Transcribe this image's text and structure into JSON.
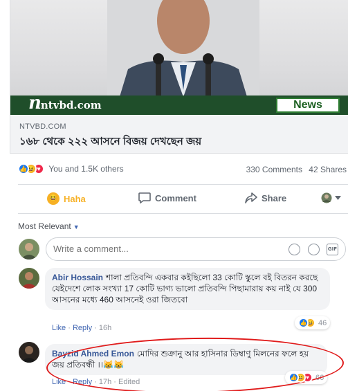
{
  "preview": {
    "brand_logo": "ntvbd.com",
    "badge": "News",
    "domain": "NTVBD.COM",
    "headline": "১৬৮ থেকে ২২২ আসনে বিজয় দেখছেন জয়"
  },
  "stats": {
    "reactions": [
      "like",
      "haha",
      "love"
    ],
    "others": "You and 1.5K others",
    "comments": "330 Comments",
    "shares": "42 Shares"
  },
  "actions": {
    "reaction": "Haha",
    "comment": "Comment",
    "share": "Share"
  },
  "sort": {
    "label": "Most Relevant"
  },
  "composer": {
    "placeholder": "Write a comment..."
  },
  "comments": [
    {
      "author": "Abir Hossain",
      "text": "শালা প্রতিবন্দি একবার কইছিলো 33 কোটি স্কুলে বই বিতরন করছে যেইদেশে লোক সংখ্যা 17 কোটি ভাগ্য ভালো প্রতিবন্দি পিছামারায় কয় নাই যে 300 আসনের মধ্যে 460 আসনেই ওরা জিতবো",
      "like": "Like",
      "reply": "Reply",
      "time": "16h",
      "reaction_count": "46"
    },
    {
      "author": "Bayzid Ahmed Emon",
      "text": "মোদির শুক্রানু আর হাসিনার ডিম্বাণু মিলনের ফলে হয় জয় প্রতিবন্ধী ।।😹😹",
      "like": "Like",
      "reply": "Reply",
      "time": "17h",
      "edited": "Edited",
      "reaction_count": "66"
    }
  ],
  "colors": {
    "link_blue": "#385898",
    "like_blue": "#1877f2",
    "haha_yellow": "#f7b125",
    "love_red": "#f0284a",
    "annotation_red": "#e01b1b"
  }
}
